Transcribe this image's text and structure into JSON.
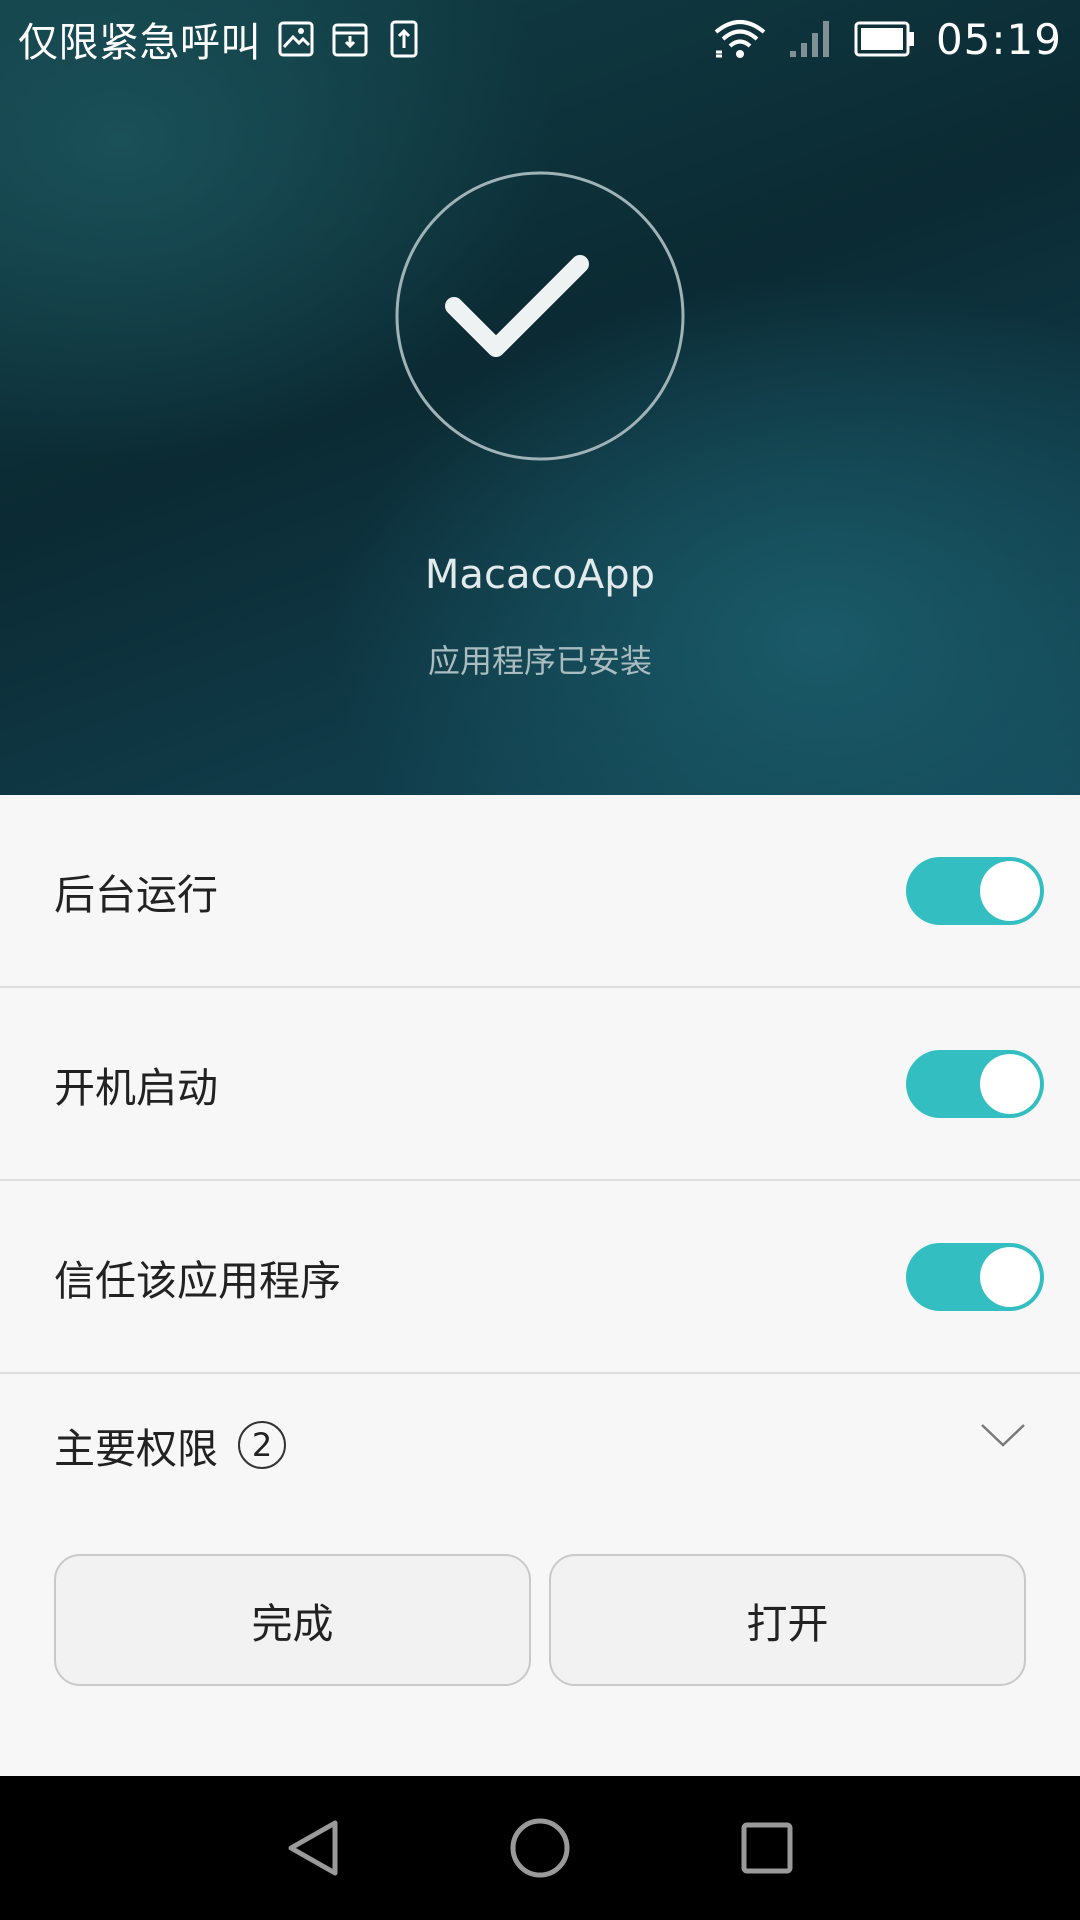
{
  "status_bar": {
    "carrier": "仅限紧急呼叫",
    "time": "05:19",
    "notification_icons": [
      "image-icon",
      "download-box-icon",
      "upload-icon"
    ],
    "system_icons": [
      "wifi-icon",
      "signal-icon",
      "battery-icon"
    ]
  },
  "hero": {
    "app_name": "MacacoApp",
    "status": "应用程序已安装",
    "icon": "check-icon"
  },
  "settings": {
    "items": [
      {
        "label": "后台运行",
        "enabled": true
      },
      {
        "label": "开机启动",
        "enabled": true
      },
      {
        "label": "信任该应用程序",
        "enabled": true
      }
    ]
  },
  "permissions": {
    "label": "主要权限",
    "count": "2"
  },
  "actions": {
    "done_label": "完成",
    "open_label": "打开"
  },
  "colors": {
    "accent": "#33bfc1",
    "hero_dark": "#0b2a33",
    "hero_light": "#1a5a68",
    "background": "#f7f7f7"
  }
}
